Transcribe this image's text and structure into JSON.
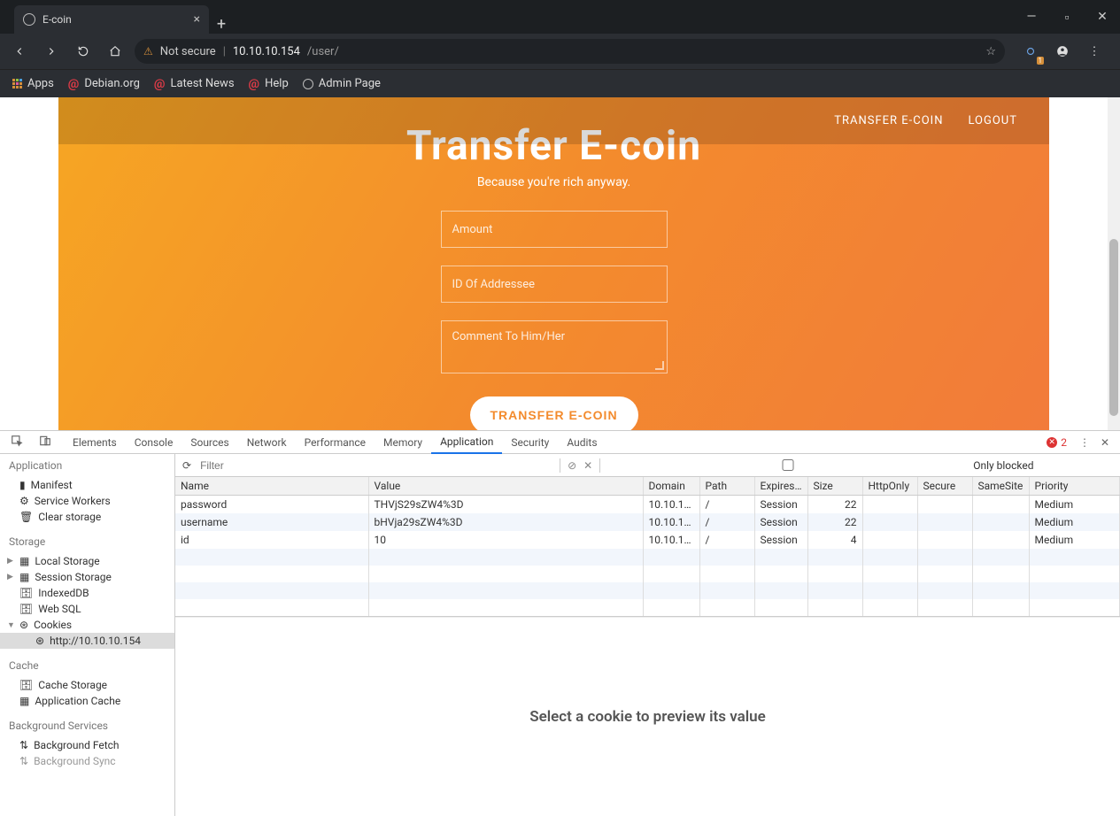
{
  "browser": {
    "tab_title": "E-coin",
    "security_label": "Not secure",
    "url_host": "10.10.10.154",
    "url_path": "/user/",
    "bookmarks": [
      "Apps",
      "Debian.org",
      "Latest News",
      "Help",
      "Admin Page"
    ],
    "ext_badge": "1"
  },
  "page": {
    "nav": {
      "transfer": "TRANSFER E-COIN",
      "logout": "LOGOUT"
    },
    "hero_title": "Transfer E-coin",
    "hero_sub": "Because you're rich anyway.",
    "ph_amount": "Amount",
    "ph_addressee": "ID Of Addressee",
    "ph_comment": "Comment To Him/Her",
    "submit": "TRANSFER E-COIN"
  },
  "devtools": {
    "tabs": [
      "Elements",
      "Console",
      "Sources",
      "Network",
      "Performance",
      "Memory",
      "Application",
      "Security",
      "Audits"
    ],
    "active_tab": "Application",
    "error_count": "2",
    "filter_placeholder": "Filter",
    "only_blocked": "Only blocked",
    "sidebar": {
      "application": {
        "title": "Application",
        "items": [
          "Manifest",
          "Service Workers",
          "Clear storage"
        ]
      },
      "storage": {
        "title": "Storage",
        "items": [
          "Local Storage",
          "Session Storage",
          "IndexedDB",
          "Web SQL",
          "Cookies"
        ],
        "cookie_origin": "http://10.10.10.154"
      },
      "cache": {
        "title": "Cache",
        "items": [
          "Cache Storage",
          "Application Cache"
        ]
      },
      "bg": {
        "title": "Background Services",
        "items": [
          "Background Fetch",
          "Background Sync"
        ]
      }
    },
    "cookie_headers": [
      "Name",
      "Value",
      "Domain",
      "Path",
      "Expires…",
      "Size",
      "HttpOnly",
      "Secure",
      "SameSite",
      "Priority"
    ],
    "cookies": [
      {
        "name": "password",
        "value": "THVjS29sZW4%3D",
        "domain": "10.10.1…",
        "path": "/",
        "expires": "Session",
        "size": "22",
        "httpOnly": "",
        "secure": "",
        "samesite": "",
        "priority": "Medium"
      },
      {
        "name": "username",
        "value": "bHVja29sZW4%3D",
        "domain": "10.10.1…",
        "path": "/",
        "expires": "Session",
        "size": "22",
        "httpOnly": "",
        "secure": "",
        "samesite": "",
        "priority": "Medium"
      },
      {
        "name": "id",
        "value": "10",
        "domain": "10.10.1…",
        "path": "/",
        "expires": "Session",
        "size": "4",
        "httpOnly": "",
        "secure": "",
        "samesite": "",
        "priority": "Medium"
      }
    ],
    "preview_msg": "Select a cookie to preview its value"
  }
}
